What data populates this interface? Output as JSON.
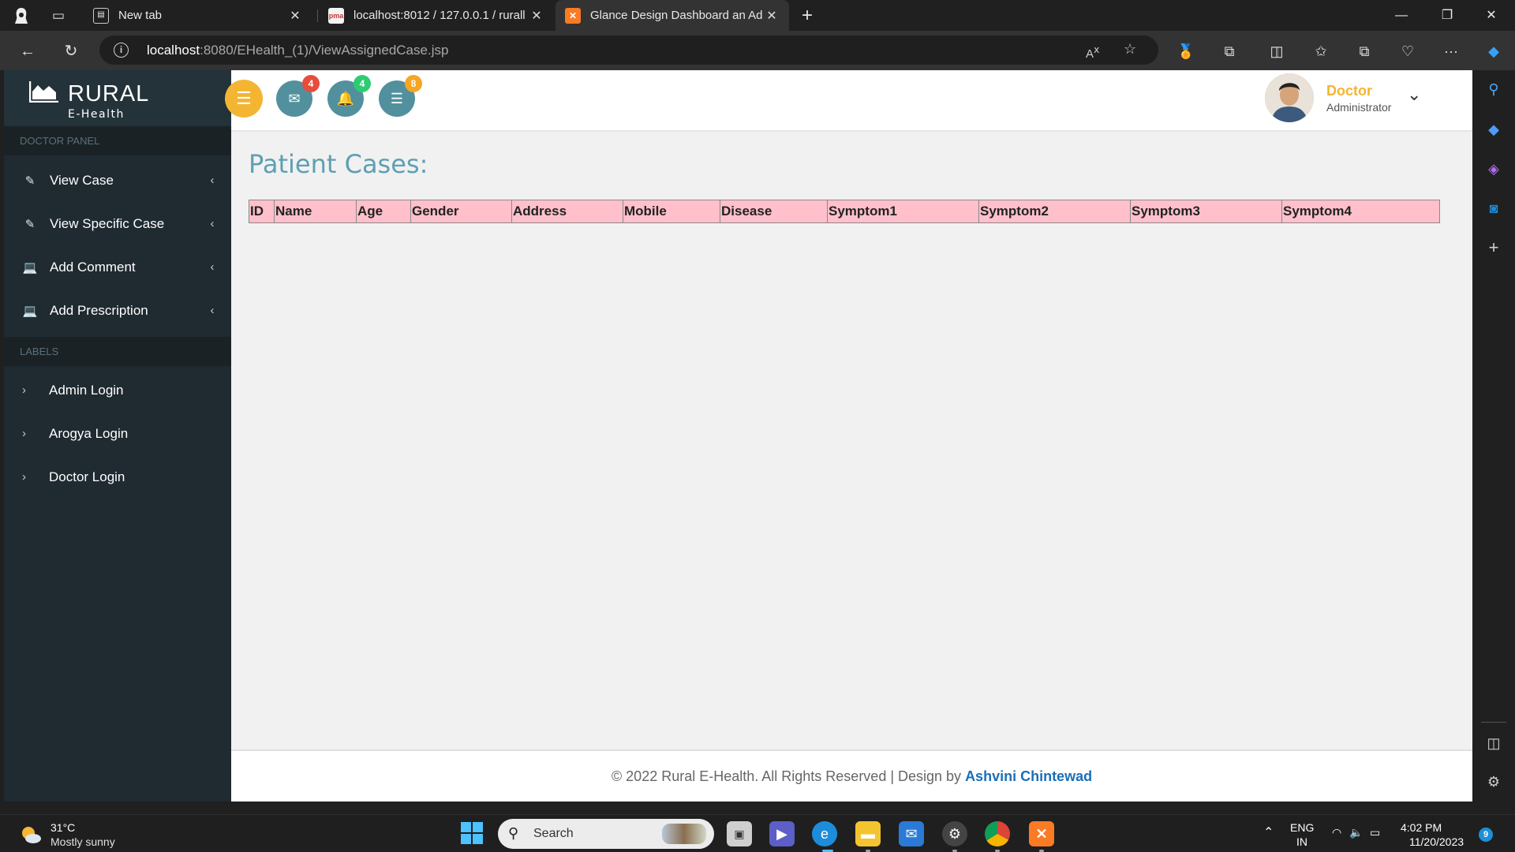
{
  "browser": {
    "tabs": [
      {
        "title": "New tab",
        "active": false
      },
      {
        "title": "localhost:8012 / 127.0.0.1 / rurall",
        "active": false
      },
      {
        "title": "Glance Design Dashboard an Ad",
        "active": true
      }
    ],
    "url_host": "localhost",
    "url_rest": ":8080/EHealth_(1)/ViewAssignedCase.jsp"
  },
  "brand": {
    "name": "RURAL",
    "subtitle": "E-Health"
  },
  "sidebar": {
    "panel_header": "DOCTOR PANEL",
    "items": [
      {
        "label": "View Case",
        "icon": "edit-icon"
      },
      {
        "label": "View Specific Case",
        "icon": "edit-icon"
      },
      {
        "label": "Add Comment",
        "icon": "laptop-icon"
      },
      {
        "label": "Add Prescription",
        "icon": "laptop-icon"
      }
    ],
    "labels_header": "LABELS",
    "labels": [
      {
        "label": "Admin Login"
      },
      {
        "label": "Arogya Login"
      },
      {
        "label": "Doctor Login"
      }
    ]
  },
  "topbar": {
    "badges": {
      "messages": "4",
      "notifications": "4",
      "tasks": "8"
    },
    "profile_name": "Doctor",
    "profile_role": "Administrator"
  },
  "main": {
    "title": "Patient Cases:",
    "table_headers": [
      "ID",
      "Name",
      "Age",
      "Gender",
      "Address",
      "Mobile",
      "Disease",
      "Symptom1",
      "Symptom2",
      "Symptom3",
      "Symptom4"
    ]
  },
  "footer": {
    "text": "© 2022 Rural E-Health. All Rights Reserved | Design by ",
    "author": "Ashvini Chintewad"
  },
  "taskbar": {
    "weather_temp": "31°C",
    "weather_cond": "Mostly sunny",
    "search_placeholder": "Search",
    "lang_top": "ENG",
    "lang_bottom": "IN",
    "time": "4:02 PM",
    "date": "11/20/2023",
    "notification_count": "9"
  },
  "colors": {
    "sidebar_bg": "#1f2a31",
    "accent_orange": "#f3b532",
    "badge_red": "#e74c3c",
    "badge_green": "#2ecc71",
    "badge_orange": "#f5a623",
    "table_header_bg": "#ffc0cb",
    "title_blue": "#5f9fb3"
  }
}
